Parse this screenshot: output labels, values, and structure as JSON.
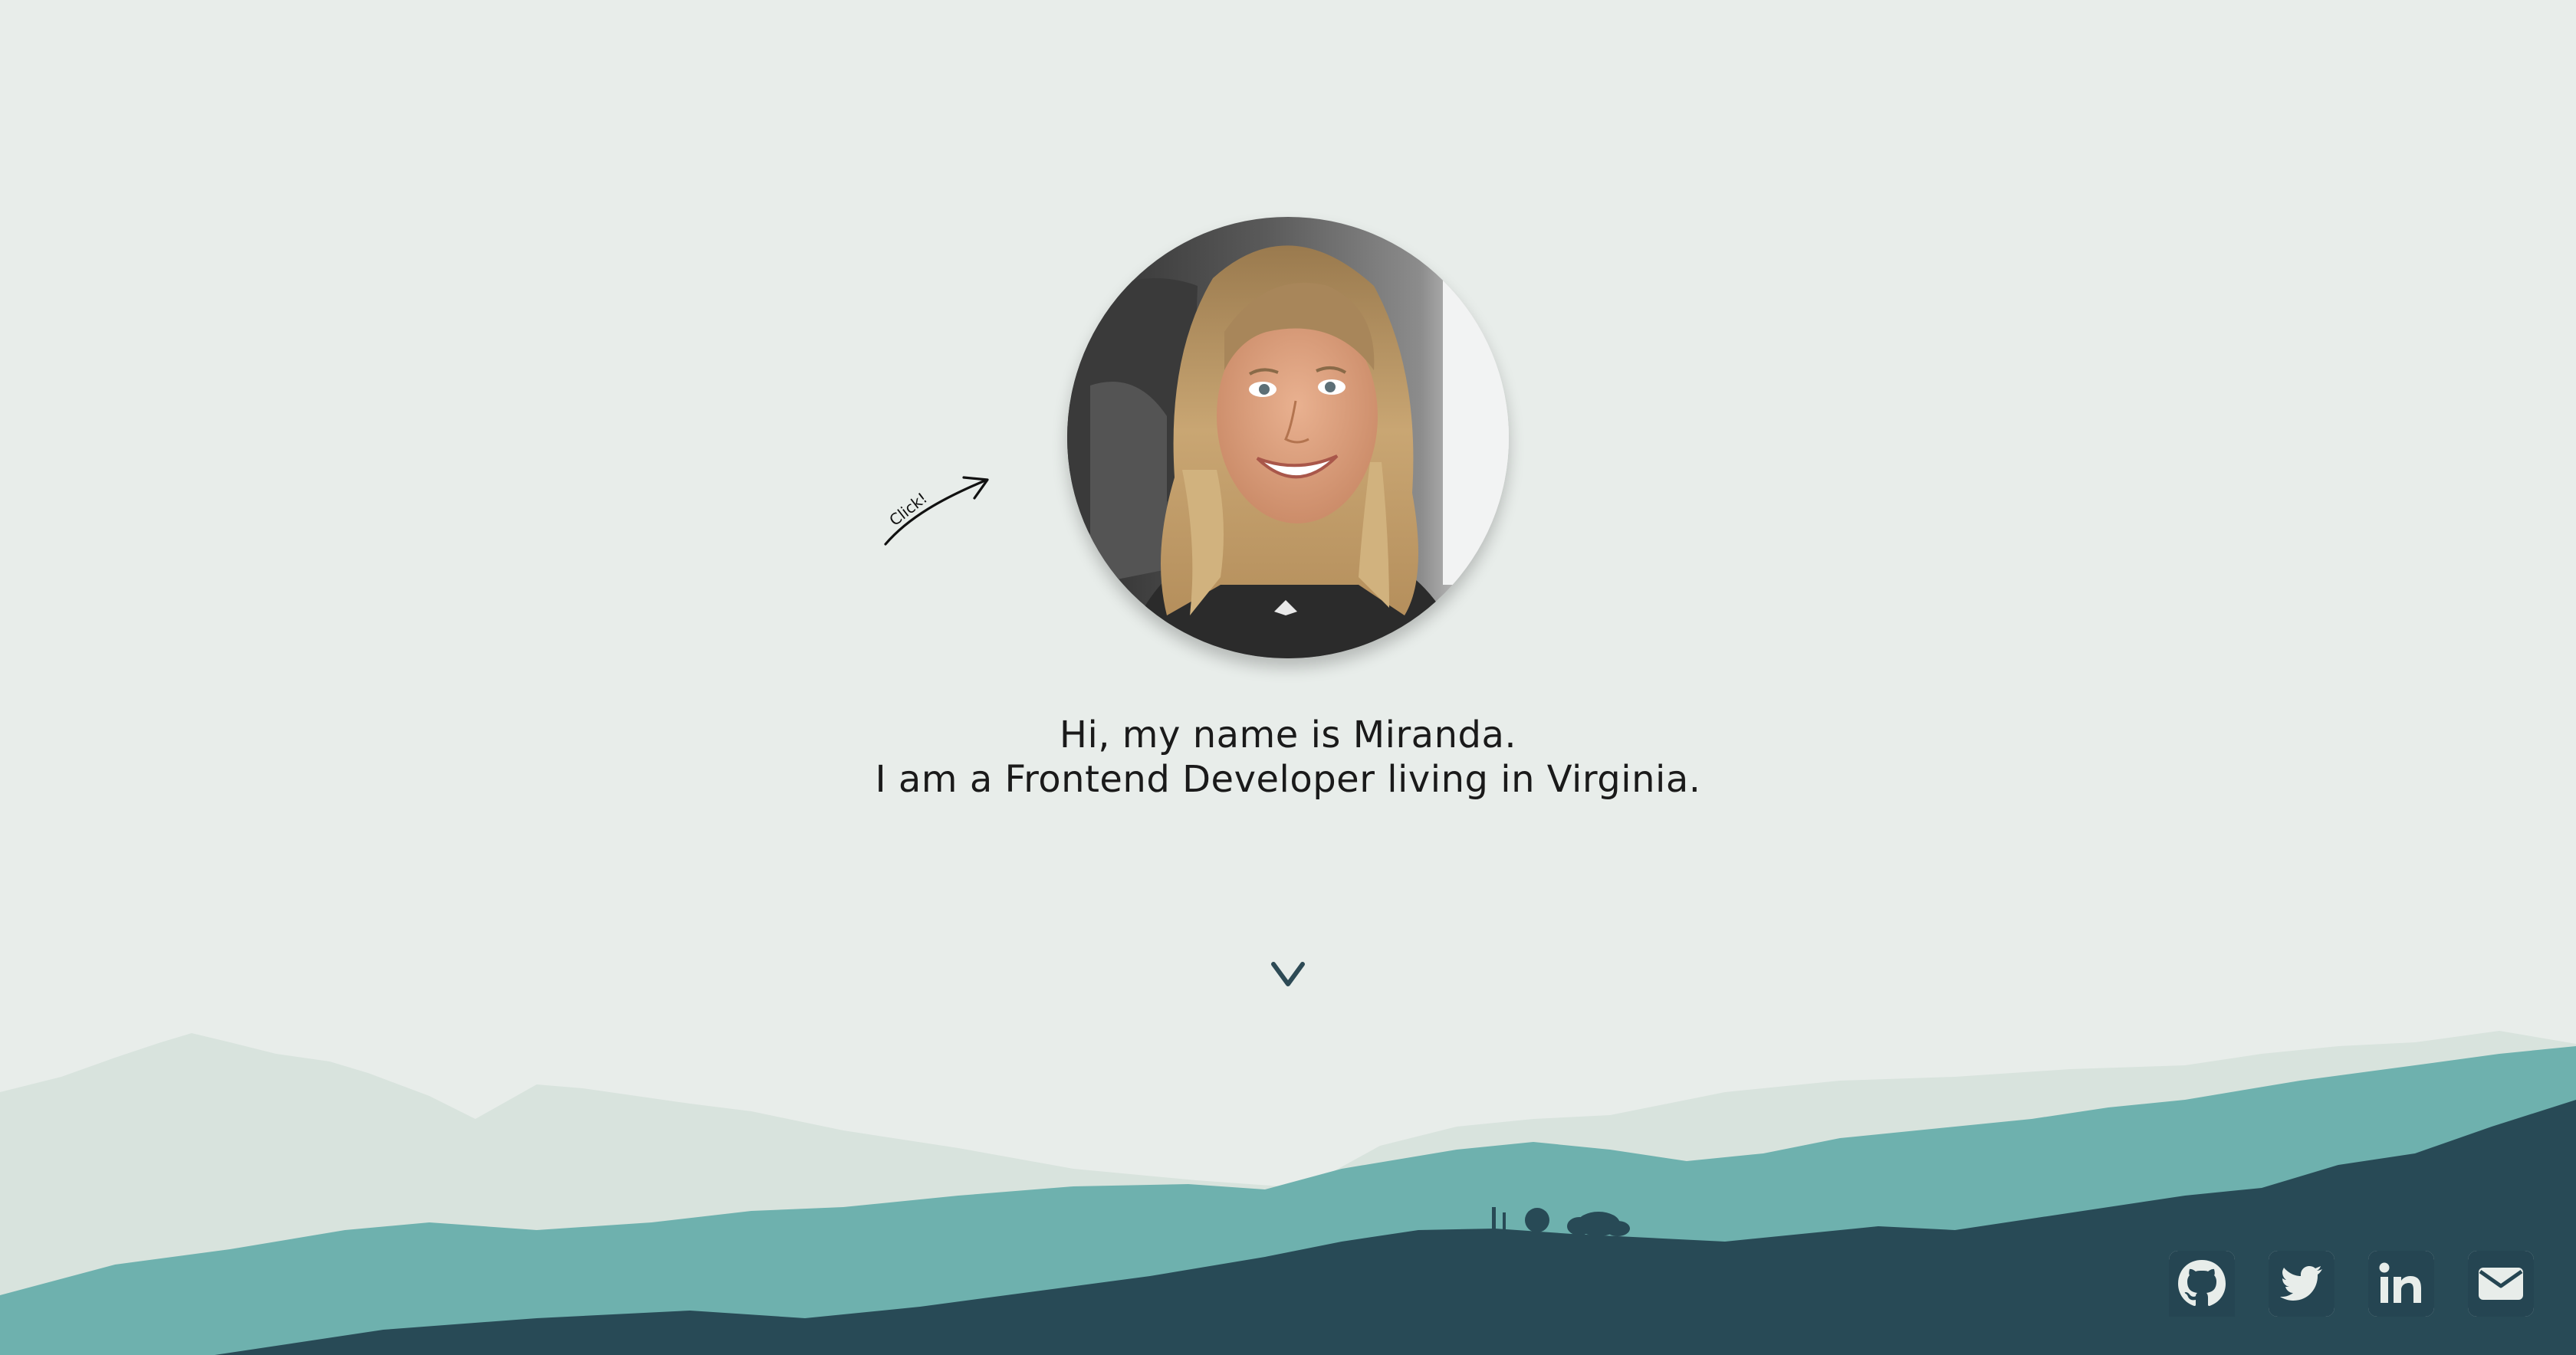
{
  "hero": {
    "greeting": "Hi, my name is Miranda.",
    "tagline": "I am a Frontend Developer living in Virginia.",
    "hint_label": "Click!",
    "photo_description": "profile-photo"
  },
  "social_links": [
    {
      "icon": "github-icon",
      "name": "github-link"
    },
    {
      "icon": "twitter-icon",
      "name": "twitter-link"
    },
    {
      "icon": "linkedin-icon",
      "name": "linkedin-link"
    },
    {
      "icon": "email-icon",
      "name": "email-link"
    }
  ],
  "colors": {
    "background": "#e8edea",
    "far_hills": "#d8e3dd",
    "mid_hills": "#6eb1ae",
    "near_hills": "#284a56",
    "icon": "#254552",
    "text": "#1a1a1a"
  }
}
